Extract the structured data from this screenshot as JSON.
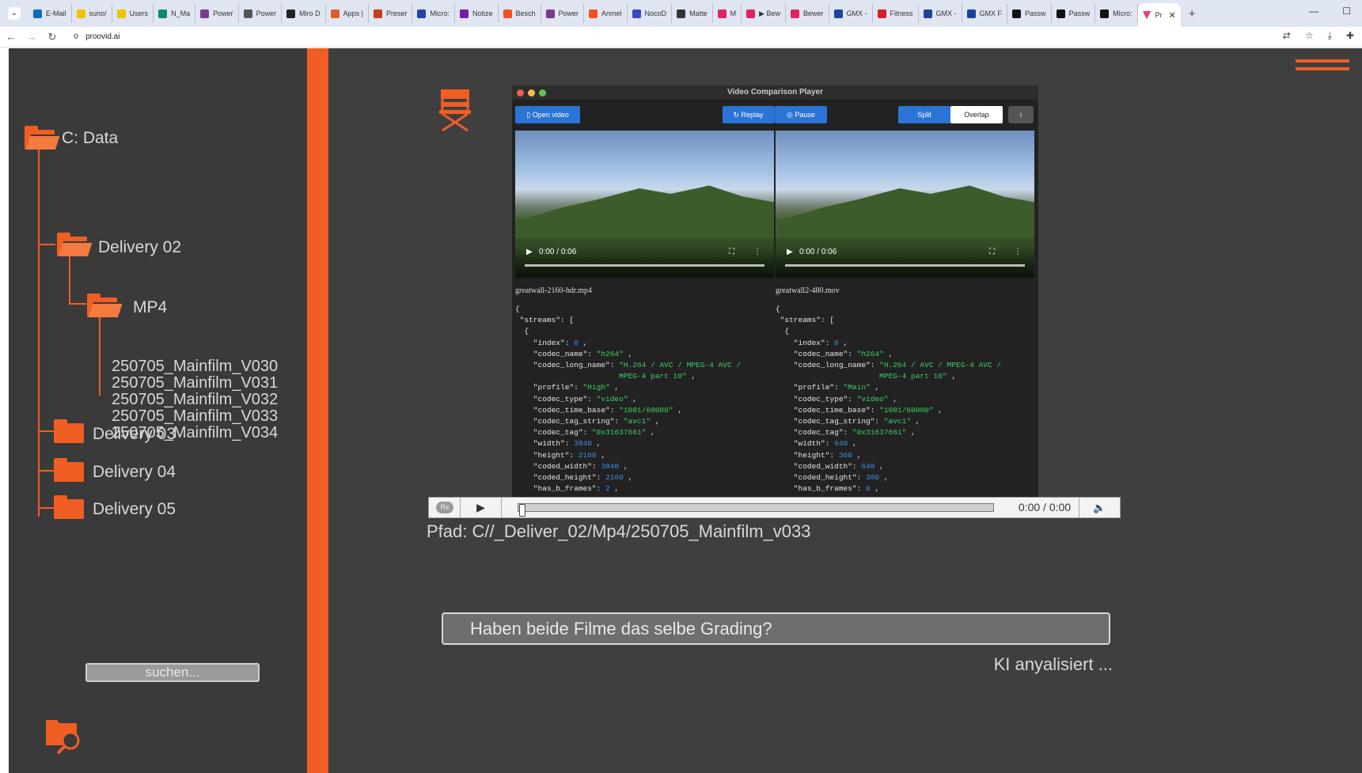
{
  "browser": {
    "tabs": [
      {
        "label": "E-Mail",
        "color": "#0f6cbd"
      },
      {
        "label": "suno/",
        "color": "#f2c200"
      },
      {
        "label": "Users",
        "color": "#f2c200"
      },
      {
        "label": "N_Ma",
        "color": "#0b8a6d"
      },
      {
        "label": "Power",
        "color": "#7a3b8f"
      },
      {
        "label": "Power",
        "color": "#555555"
      },
      {
        "label": "Miro D",
        "color": "#222222"
      },
      {
        "label": "Apps |",
        "color": "#e05a2a"
      },
      {
        "label": "Preser",
        "color": "#c43e1c"
      },
      {
        "label": "Micro:",
        "color": "#2441a8"
      },
      {
        "label": "Notize",
        "color": "#7719aa"
      },
      {
        "label": "Besch",
        "color": "#f25022"
      },
      {
        "label": "Power",
        "color": "#7a3b8f"
      },
      {
        "label": "Anmel",
        "color": "#f25022"
      },
      {
        "label": "NocoD",
        "color": "#3b4cc0"
      },
      {
        "label": "Matte",
        "color": "#333333"
      },
      {
        "label": "M",
        "color": "#e0245e"
      },
      {
        "label": "▶ Bew",
        "color": "#e0245e"
      },
      {
        "label": "Bewer",
        "color": "#e0245e"
      },
      {
        "label": "GMX -",
        "color": "#1c449b"
      },
      {
        "label": "Fitness",
        "color": "#d61f26"
      },
      {
        "label": "GMX -",
        "color": "#1c449b"
      },
      {
        "label": "GMX F",
        "color": "#1c449b"
      },
      {
        "label": "Passw",
        "color": "#111111"
      },
      {
        "label": "Passw",
        "color": "#111111"
      },
      {
        "label": "Micro:",
        "color": "#111111"
      }
    ],
    "active_tab": {
      "label": "Pr",
      "color": "#e6416f"
    },
    "url": "proovid.ai"
  },
  "sidebar": {
    "root": "C: Data",
    "delivery02": "Delivery 02",
    "mp4": "MP4",
    "files": [
      "250705_Mainfilm_V030",
      "250705_Mainfilm_V031",
      "250705_Mainfilm_V032",
      "250705_Mainfilm_V033",
      "250705_Mainfilm_V034"
    ],
    "delivery03": "Delivery 03",
    "delivery04": "Delivery 04",
    "delivery05": "Delivery 05",
    "search_placeholder": "suchen..."
  },
  "player": {
    "window_title": "Video Comparison Player",
    "open_video": "Open video",
    "replay": "Replay",
    "pause": "Pause",
    "split": "Split",
    "overlap": "Overlap",
    "info": "i",
    "left": {
      "time": "0:00 / 0:06",
      "filename": "greatwall-2160-hdr.mp4",
      "profile": "\"High\"",
      "codec_long_1": "\"H.264 / AVC / MPEG-4 AVC /",
      "codec_long_2": "MPEG-4 part 10\"",
      "width": "3840",
      "height": "2160",
      "coded_width": "3840",
      "coded_height": "2160",
      "has_b_frames": "2"
    },
    "right": {
      "time": "0:00 / 0:06",
      "filename": "greatwall2-480.mov",
      "profile": "\"Main\"",
      "codec_long_1": "\"H.264 / AVC / MPEG-4 AVC /",
      "codec_long_2": "MPEG-4 part 10\"",
      "width": "640",
      "height": "360",
      "coded_width": "640",
      "coded_height": "360",
      "has_b_frames": "0"
    },
    "shared": {
      "index": "0",
      "codec_name": "\"h264\"",
      "codec_type": "\"video\"",
      "codec_time_base": "\"1001/60000\"",
      "codec_tag_string": "\"avc1\"",
      "codec_tag": "\"0x31637661\""
    }
  },
  "controls": {
    "rx": "Rx",
    "time": "0:00 / 0:00"
  },
  "path": "Pfad: C//_Deliver_02/Mp4/250705_Mainfilm_v033",
  "question": "Haben beide Filme das selbe Grading?",
  "status": "KI anyalisiert ...",
  "colors": {
    "accent": "#f05e23",
    "panel": "#3b3b3b"
  }
}
